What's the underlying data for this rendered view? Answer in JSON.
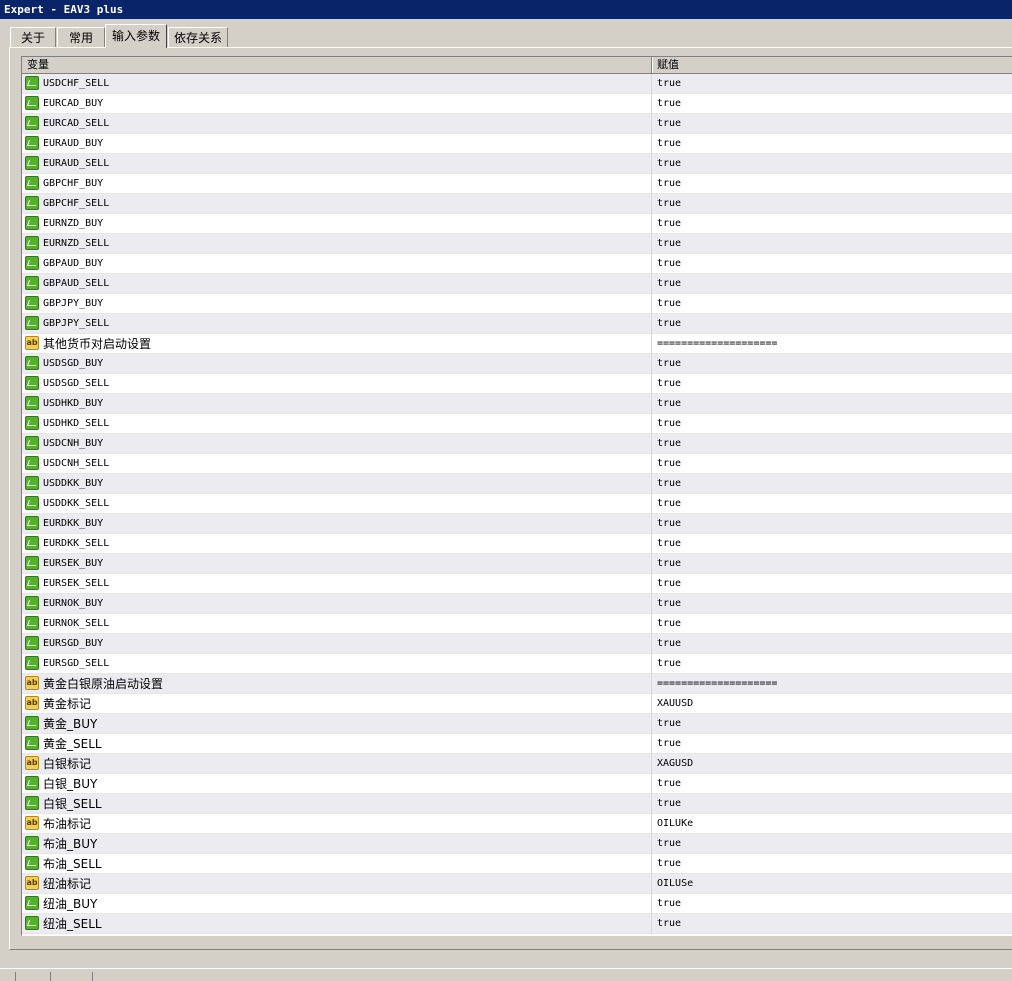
{
  "window": {
    "title": "Expert - EAV3 plus"
  },
  "tabs": [
    {
      "label": "关于"
    },
    {
      "label": "常用"
    },
    {
      "label": "输入参数"
    },
    {
      "label": "依存关系"
    }
  ],
  "table": {
    "columns": {
      "variable": "变量",
      "value": "赋值"
    },
    "rows": [
      {
        "name": "USDCHF_SELL",
        "value": "true",
        "icon": "bool-icon"
      },
      {
        "name": "EURCAD_BUY",
        "value": "true",
        "icon": "bool-icon"
      },
      {
        "name": "EURCAD_SELL",
        "value": "true",
        "icon": "bool-icon"
      },
      {
        "name": "EURAUD_BUY",
        "value": "true",
        "icon": "bool-icon"
      },
      {
        "name": "EURAUD_SELL",
        "value": "true",
        "icon": "bool-icon"
      },
      {
        "name": "GBPCHF_BUY",
        "value": "true",
        "icon": "bool-icon"
      },
      {
        "name": "GBPCHF_SELL",
        "value": "true",
        "icon": "bool-icon"
      },
      {
        "name": "EURNZD_BUY",
        "value": "true",
        "icon": "bool-icon"
      },
      {
        "name": "EURNZD_SELL",
        "value": "true",
        "icon": "bool-icon"
      },
      {
        "name": "GBPAUD_BUY",
        "value": "true",
        "icon": "bool-icon"
      },
      {
        "name": "GBPAUD_SELL",
        "value": "true",
        "icon": "bool-icon"
      },
      {
        "name": "GBPJPY_BUY",
        "value": "true",
        "icon": "bool-icon"
      },
      {
        "name": "GBPJPY_SELL",
        "value": "true",
        "icon": "bool-icon"
      },
      {
        "name": "其他货币对启动设置",
        "value": "====================",
        "icon": "string-icon"
      },
      {
        "name": "USDSGD_BUY",
        "value": "true",
        "icon": "bool-icon"
      },
      {
        "name": "USDSGD_SELL",
        "value": "true",
        "icon": "bool-icon"
      },
      {
        "name": "USDHKD_BUY",
        "value": "true",
        "icon": "bool-icon"
      },
      {
        "name": "USDHKD_SELL",
        "value": "true",
        "icon": "bool-icon"
      },
      {
        "name": "USDCNH_BUY",
        "value": "true",
        "icon": "bool-icon"
      },
      {
        "name": "USDCNH_SELL",
        "value": "true",
        "icon": "bool-icon"
      },
      {
        "name": "USDDKK_BUY",
        "value": "true",
        "icon": "bool-icon"
      },
      {
        "name": "USDDKK_SELL",
        "value": "true",
        "icon": "bool-icon"
      },
      {
        "name": "EURDKK_BUY",
        "value": "true",
        "icon": "bool-icon"
      },
      {
        "name": "EURDKK_SELL",
        "value": "true",
        "icon": "bool-icon"
      },
      {
        "name": "EURSEK_BUY",
        "value": "true",
        "icon": "bool-icon"
      },
      {
        "name": "EURSEK_SELL",
        "value": "true",
        "icon": "bool-icon"
      },
      {
        "name": "EURNOK_BUY",
        "value": "true",
        "icon": "bool-icon"
      },
      {
        "name": "EURNOK_SELL",
        "value": "true",
        "icon": "bool-icon"
      },
      {
        "name": "EURSGD_BUY",
        "value": "true",
        "icon": "bool-icon"
      },
      {
        "name": "EURSGD_SELL",
        "value": "true",
        "icon": "bool-icon"
      },
      {
        "name": "黄金白银原油启动设置",
        "value": "====================",
        "icon": "string-icon"
      },
      {
        "name": "黄金标记",
        "value": "XAUUSD",
        "icon": "string-icon"
      },
      {
        "name": "黄金_BUY",
        "value": "true",
        "icon": "bool-icon"
      },
      {
        "name": "黄金_SELL",
        "value": "true",
        "icon": "bool-icon"
      },
      {
        "name": "白银标记",
        "value": "XAGUSD",
        "icon": "string-icon"
      },
      {
        "name": "白银_BUY",
        "value": "true",
        "icon": "bool-icon"
      },
      {
        "name": "白银_SELL",
        "value": "true",
        "icon": "bool-icon"
      },
      {
        "name": "布油标记",
        "value": "OILUKe",
        "icon": "string-icon"
      },
      {
        "name": "布油_BUY",
        "value": "true",
        "icon": "bool-icon"
      },
      {
        "name": "布油_SELL",
        "value": "true",
        "icon": "bool-icon"
      },
      {
        "name": "纽油标记",
        "value": "OILUSe",
        "icon": "string-icon"
      },
      {
        "name": "纽油_BUY",
        "value": "true",
        "icon": "bool-icon"
      },
      {
        "name": "纽油_SELL",
        "value": "true",
        "icon": "bool-icon"
      }
    ]
  },
  "icons": {
    "bool_glyph": "",
    "string_glyph": "ab"
  }
}
